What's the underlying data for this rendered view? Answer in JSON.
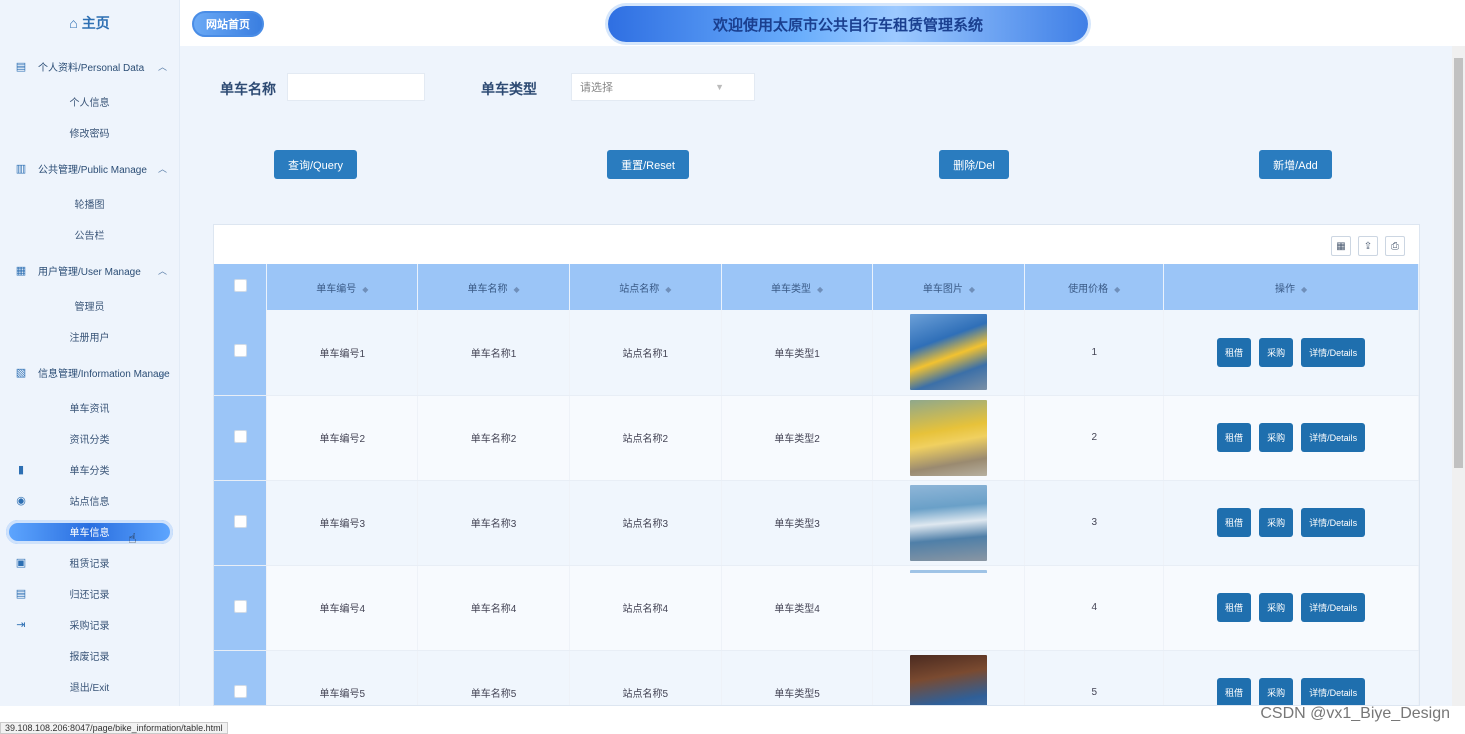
{
  "sidebar": {
    "home": "主页",
    "groups": [
      {
        "label": "个人资料/Personal Data",
        "subs": [
          "个人信息",
          "修改密码"
        ]
      },
      {
        "label": "公共管理/Public Manage",
        "subs": [
          "轮播图",
          "公告栏"
        ]
      },
      {
        "label": "用户管理/User Manage",
        "subs": [
          "管理员",
          "注册用户"
        ]
      },
      {
        "label": "信息管理/Information Manage",
        "subs": [
          "单车资讯",
          "资讯分类"
        ]
      }
    ],
    "items": [
      "单车分类",
      "站点信息",
      "单车信息",
      "租赁记录",
      "归还记录",
      "采购记录",
      "报废记录",
      "退出/Exit"
    ],
    "active_item": "单车信息"
  },
  "header": {
    "home_button": "网站首页",
    "title": "欢迎使用太原市公共自行车租赁管理系统"
  },
  "search": {
    "name_label": "单车名称",
    "name_value": "",
    "type_label": "单车类型",
    "type_placeholder": "请选择"
  },
  "buttons": {
    "query": "查询/Query",
    "reset": "重置/Reset",
    "delete": "删除/Del",
    "add": "新增/Add"
  },
  "table": {
    "headers": [
      "单车编号",
      "单车名称",
      "站点名称",
      "单车类型",
      "单车图片",
      "使用价格",
      "操作"
    ],
    "rows": [
      {
        "no": "单车编号1",
        "name": "单车名称1",
        "station": "站点名称1",
        "type": "单车类型1",
        "price": "1"
      },
      {
        "no": "单车编号2",
        "name": "单车名称2",
        "station": "站点名称2",
        "type": "单车类型2",
        "price": "2"
      },
      {
        "no": "单车编号3",
        "name": "单车名称3",
        "station": "站点名称3",
        "type": "单车类型3",
        "price": "3"
      },
      {
        "no": "单车编号4",
        "name": "单车名称4",
        "station": "站点名称4",
        "type": "单车类型4",
        "price": "4"
      },
      {
        "no": "单车编号5",
        "name": "单车名称5",
        "station": "站点名称5",
        "type": "单车类型5",
        "price": "5"
      }
    ],
    "row_actions": [
      "租借",
      "采购",
      "详情/Details"
    ]
  },
  "status_url": "39.108.108.206:8047/page/bike_information/table.html",
  "watermark": "CSDN @vx1_Biye_Design",
  "colors": {
    "primary": "#2a7cbf",
    "header_blue": "#9bc5f7",
    "bg": "#eef4fc"
  }
}
